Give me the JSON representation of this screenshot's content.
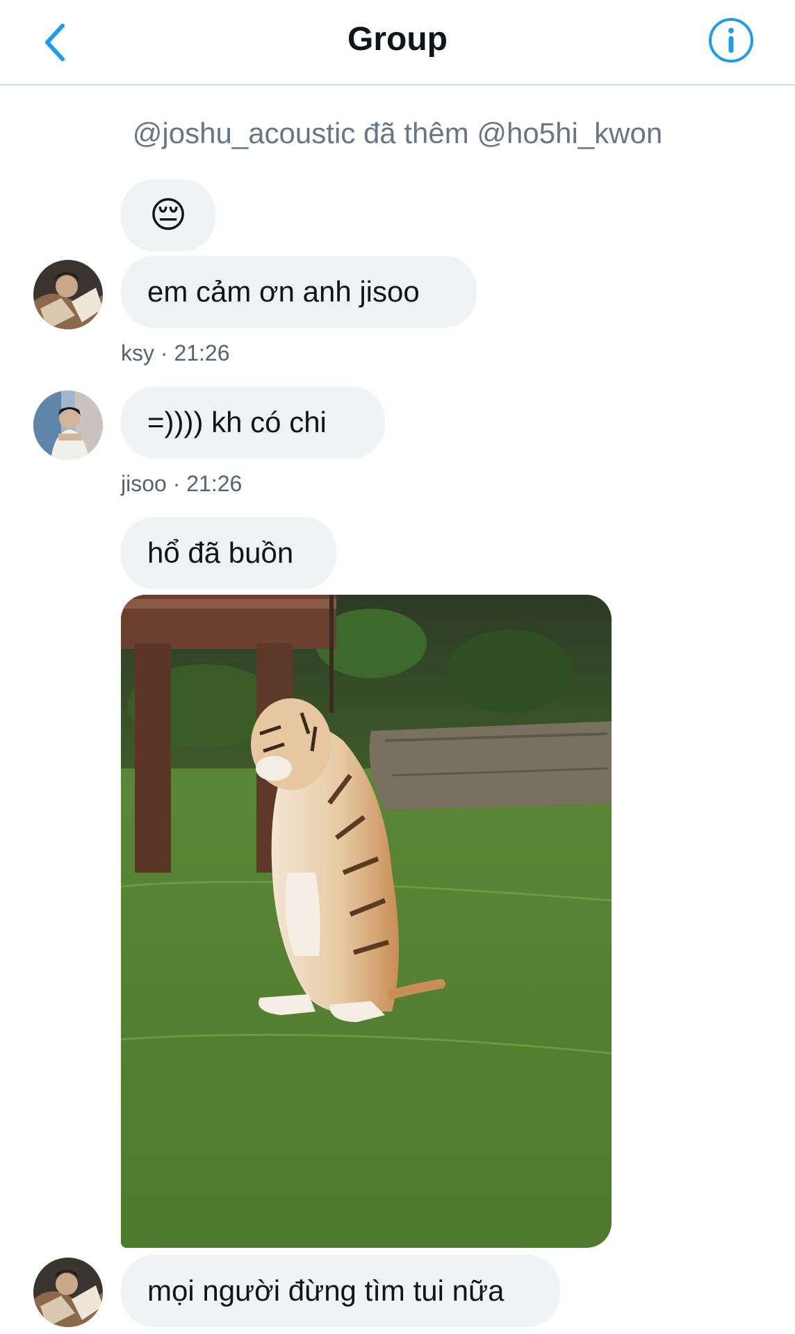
{
  "header": {
    "title": "Group",
    "back_icon": "chevron-left-icon",
    "info_icon": "info-icon",
    "accent_color": "#1d9bf0"
  },
  "system_message": "@joshu_acoustic đã thêm @ho5hi_kwon",
  "messages": [
    {
      "text": "😔"
    },
    {
      "text": "em cảm ơn anh jisoo"
    },
    {
      "meta": "ksy · 21:26"
    },
    {
      "text": "=)))) kh có chi"
    },
    {
      "meta": "jisoo · 21:26"
    },
    {
      "text": "hổ đã buồn"
    },
    {
      "media": "tiger-photo"
    },
    {
      "text": "mọi người đừng tìm tui nữa"
    }
  ]
}
